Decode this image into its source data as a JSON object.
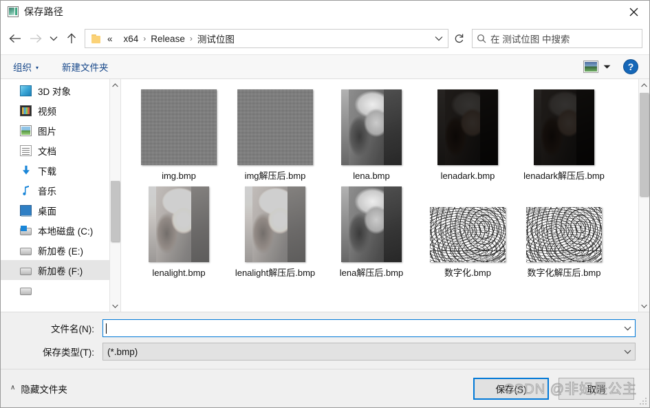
{
  "window": {
    "title": "保存路径",
    "app_icon": "picture-icon",
    "close_label": "✕"
  },
  "nav": {
    "back": "←",
    "forward": "→",
    "recent": "⌄",
    "up": "↑",
    "refresh": "↻",
    "breadcrumb_prefix": "«",
    "breadcrumbs": [
      "x64",
      "Release",
      "测试位图"
    ],
    "separator": "›",
    "dropdown": "⌄"
  },
  "search": {
    "placeholder": "在 测试位图 中搜索",
    "icon": "search-icon"
  },
  "toolbar": {
    "organize_label": "组织",
    "organize_caret": "▾",
    "new_folder_label": "新建文件夹",
    "view_icon": "picture-view-icon",
    "view_caret": "▾",
    "help_label": "?"
  },
  "sidebar": {
    "items": [
      {
        "label": "3D 对象",
        "icon": "cube-icon",
        "selected": false
      },
      {
        "label": "视频",
        "icon": "video-icon",
        "selected": false
      },
      {
        "label": "图片",
        "icon": "pictures-icon",
        "selected": false
      },
      {
        "label": "文档",
        "icon": "documents-icon",
        "selected": false
      },
      {
        "label": "下载",
        "icon": "download-icon",
        "selected": false
      },
      {
        "label": "音乐",
        "icon": "music-icon",
        "selected": false
      },
      {
        "label": "桌面",
        "icon": "desktop-icon",
        "selected": false
      },
      {
        "label": "本地磁盘 (C:)",
        "icon": "windows-drive-icon",
        "selected": false
      },
      {
        "label": "新加卷 (E:)",
        "icon": "drive-icon",
        "selected": false
      },
      {
        "label": "新加卷 (F:)",
        "icon": "drive-icon",
        "selected": true
      }
    ],
    "scroll_up": "⌃",
    "scroll_down": "⌄"
  },
  "files": {
    "scroll_up": "⌃",
    "scroll_down": "⌄",
    "items": [
      {
        "name": "img.bmp",
        "thumb": "noise"
      },
      {
        "name": "img解压后.bmp",
        "thumb": "noise"
      },
      {
        "name": "lena.bmp",
        "thumb": "lena-gray"
      },
      {
        "name": "lenadark.bmp",
        "thumb": "lena-dark"
      },
      {
        "name": "lenadark解压后.bmp",
        "thumb": "lena-dark"
      },
      {
        "name": "lenalight.bmp",
        "thumb": "lena-light"
      },
      {
        "name": "lenalight解压后.bmp",
        "thumb": "lena-light"
      },
      {
        "name": "lena解压后.bmp",
        "thumb": "lena-gray"
      },
      {
        "name": "数字化.bmp",
        "thumb": "contour-map"
      },
      {
        "name": "数字化解压后.bmp",
        "thumb": "contour-map"
      }
    ]
  },
  "form": {
    "filename_label": "文件名(N):",
    "filename_value": "",
    "filetype_label": "保存类型(T):",
    "filetype_value": "(*.bmp)",
    "combo_caret": "⌄"
  },
  "footer": {
    "hide_folders_caret": "∧",
    "hide_folders_label": "隐藏文件夹",
    "save_label": "保存(S)",
    "cancel_label": "取消"
  },
  "watermark": {
    "text": "CSDN @非妃是公主"
  },
  "colors": {
    "accent": "#0078d7",
    "link": "#16478a",
    "selection": "#e5e5e5",
    "help_blue": "#1567b8"
  }
}
